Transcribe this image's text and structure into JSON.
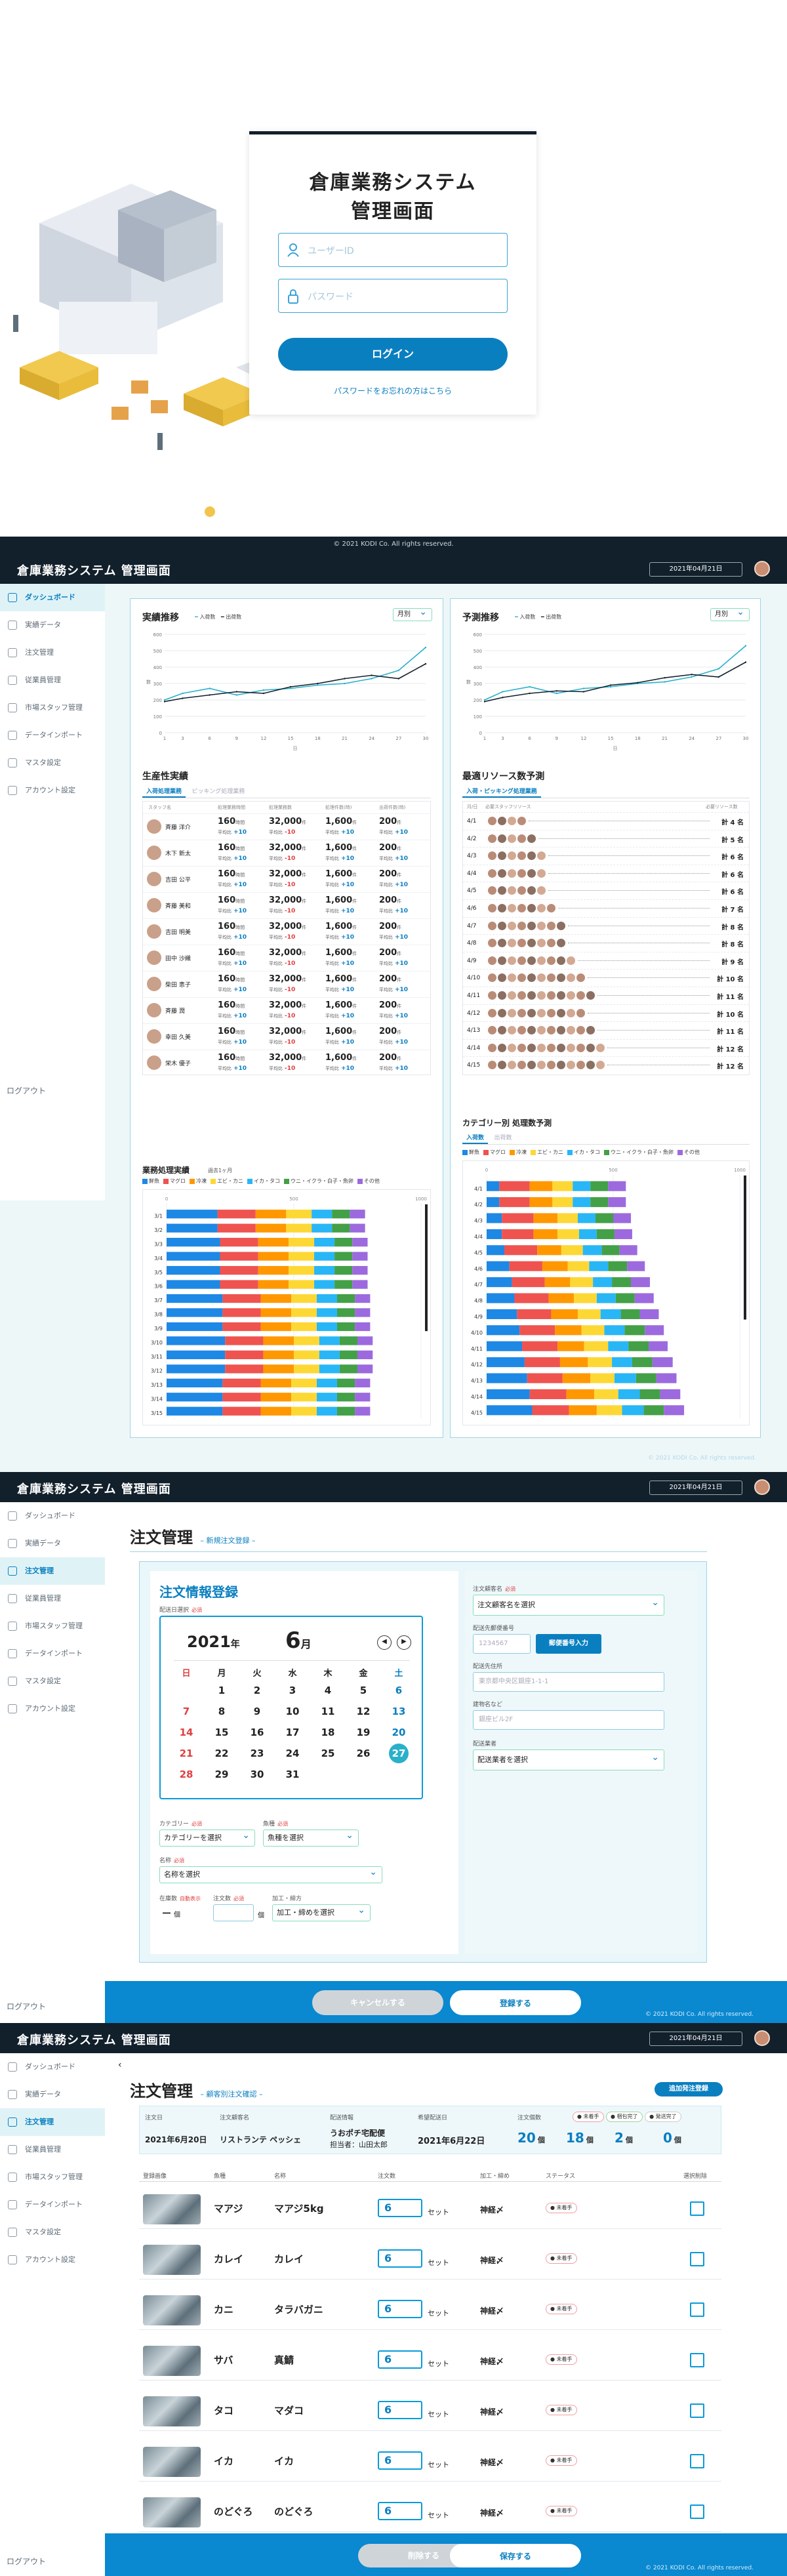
{
  "login": {
    "title_line1": "倉庫業務システム",
    "title_line2": "管理画面",
    "user_placeholder": "ユーザーID",
    "password_placeholder": "パスワード",
    "login_button": "ログイン",
    "forgot_link": "パスワードをお忘れの方はこちら",
    "copyright": "© 2021 KODI Co. All rights reserved."
  },
  "app": {
    "title": "倉庫業務システム 管理画面",
    "date": "2021年04月21日",
    "copyright": "© 2021 KODI Co. All rights reserved.",
    "logout": "ログアウト"
  },
  "sidebar": {
    "items": [
      {
        "label": "ダッシュボード",
        "icon": "home-icon"
      },
      {
        "label": "実績データ",
        "icon": "chart-icon"
      },
      {
        "label": "注文管理",
        "icon": "order-icon"
      },
      {
        "label": "従業員管理",
        "icon": "staff-icon"
      },
      {
        "label": "市場スタッフ管理",
        "icon": "people-icon"
      },
      {
        "label": "データインポート",
        "icon": "import-icon"
      },
      {
        "label": "マスタ設定",
        "icon": "master-icon"
      },
      {
        "label": "アカウント設定",
        "icon": "gear-icon"
      }
    ]
  },
  "dashboard": {
    "results_title": "実績推移",
    "results_legend": [
      "入荷数",
      "出荷数"
    ],
    "forecast_title": "予測推移",
    "forecast_legend": [
      "入荷数",
      "出荷数"
    ],
    "period_select": "月別",
    "productivity_title": "生産性実績",
    "productivity_tabs": [
      "入荷処理業務",
      "ピッキング処理業務"
    ],
    "productivity_headers": [
      "スタッフ名",
      "処理業務時間",
      "処理業務数",
      "処理件数(時)",
      "出荷件数(時)"
    ],
    "staff": [
      {
        "name": "斉藤 洋介",
        "d1": "+10",
        "d2": "-10",
        "d3": "+10",
        "d4": "+10"
      },
      {
        "name": "木下 新太",
        "d1": "+10",
        "d2": "-10",
        "d3": "+10",
        "d4": "+10"
      },
      {
        "name": "吉田 公平",
        "d1": "+10",
        "d2": "-10",
        "d3": "+10",
        "d4": "+10"
      },
      {
        "name": "斉藤 美和",
        "d1": "+10",
        "d2": "-10",
        "d3": "+10",
        "d4": "+10"
      },
      {
        "name": "吉田 明美",
        "d1": "+10",
        "d2": "-10",
        "d3": "+10",
        "d4": "+10"
      },
      {
        "name": "田中 沙織",
        "d1": "+10",
        "d2": "-10",
        "d3": "+10",
        "d4": "+10"
      },
      {
        "name": "柴田 恵子",
        "d1": "+10",
        "d2": "-10",
        "d3": "+10",
        "d4": "+10"
      },
      {
        "name": "斉藤 潤",
        "d1": "+10",
        "d2": "-10",
        "d3": "+10",
        "d4": "+10"
      },
      {
        "name": "幸田 久美",
        "d1": "+10",
        "d2": "-10",
        "d3": "+10",
        "d4": "+10"
      },
      {
        "name": "栄木 優子",
        "d1": "+10",
        "d2": "-10",
        "d3": "+10",
        "d4": "+10"
      }
    ],
    "metric_values": {
      "hours": "160",
      "hours_unit": "時間",
      "tasks": "32,000",
      "tasks_unit": "件",
      "rate1": "1,600",
      "rate1_unit": "件",
      "rate2": "200",
      "rate2_unit": "件",
      "avg_prefix": "平均比"
    },
    "resource_title": "最適リソース数予測",
    "resource_tabs": [
      "入荷・ピッキング処理業務"
    ],
    "resource_headers": [
      "月/日",
      "必要スタッフリソース",
      "必要リソース数"
    ],
    "resource_rows": [
      {
        "date": "4/1",
        "count": "計 4 名"
      },
      {
        "date": "4/2",
        "count": "計 5 名"
      },
      {
        "date": "4/3",
        "count": "計 6 名"
      },
      {
        "date": "4/4",
        "count": "計 6 名"
      },
      {
        "date": "4/5",
        "count": "計 6 名"
      },
      {
        "date": "4/6",
        "count": "計 7 名"
      },
      {
        "date": "4/7",
        "count": "計 8 名"
      },
      {
        "date": "4/8",
        "count": "計 8 名"
      },
      {
        "date": "4/9",
        "count": "計 9 名"
      },
      {
        "date": "4/10",
        "count": "計 10 名"
      },
      {
        "date": "4/11",
        "count": "計 11 名"
      },
      {
        "date": "4/12",
        "count": "計 10 名"
      },
      {
        "date": "4/13",
        "count": "計 11 名"
      },
      {
        "date": "4/14",
        "count": "計 12 名"
      },
      {
        "date": "4/15",
        "count": "計 12 名"
      }
    ],
    "category_colors": [
      "#1e88e5",
      "#ef5350",
      "#ff9800",
      "#fdd835",
      "#29b6f6",
      "#43a047",
      "#9c6ade",
      "#b39ddb"
    ],
    "category_names": [
      "鮮魚",
      "マグロ",
      "冷凍",
      "エビ・カニ",
      "イカ・タコ",
      "ウニ・イクラ・白子・魚卵",
      "その他"
    ],
    "task_title": "業務処理実績",
    "task_subtitle": "過去1ヶ月",
    "category_forecast_title": "カテゴリー別 処理数予測",
    "category_forecast_tabs": [
      "入荷数",
      "出荷数"
    ]
  },
  "chart_data": [
    {
      "type": "line",
      "title": "実績推移",
      "x": [
        1,
        3,
        6,
        9,
        12,
        15,
        18,
        21,
        24,
        27,
        30
      ],
      "series": [
        {
          "name": "入荷数",
          "values": [
            200,
            240,
            270,
            230,
            260,
            270,
            290,
            300,
            330,
            380,
            520
          ]
        },
        {
          "name": "出荷数",
          "values": [
            190,
            210,
            230,
            250,
            240,
            280,
            300,
            330,
            350,
            330,
            420
          ]
        }
      ],
      "xlabel": "日",
      "ylabel": "数",
      "ylim": [
        0,
        600
      ]
    },
    {
      "type": "line",
      "title": "予測推移",
      "x": [
        1,
        3,
        6,
        9,
        12,
        15,
        18,
        21,
        24,
        27,
        30
      ],
      "series": [
        {
          "name": "入荷数",
          "values": [
            200,
            250,
            280,
            240,
            270,
            280,
            300,
            310,
            340,
            390,
            530
          ]
        },
        {
          "name": "出荷数",
          "values": [
            190,
            215,
            240,
            255,
            250,
            290,
            305,
            335,
            355,
            340,
            430
          ]
        }
      ],
      "xlabel": "日",
      "ylabel": "数",
      "ylim": [
        0,
        600
      ]
    },
    {
      "type": "bar",
      "title": "業務処理実績",
      "categories": [
        "3/1",
        "3/2",
        "3/3",
        "3/4",
        "3/5",
        "3/6",
        "3/7",
        "3/8",
        "3/9",
        "3/10",
        "3/11",
        "3/12",
        "3/13",
        "3/14",
        "3/15"
      ],
      "xlim": [
        0,
        1000
      ],
      "series": [
        {
          "name": "鮮魚",
          "values": [
            200,
            200,
            210,
            210,
            210,
            210,
            220,
            220,
            220,
            230,
            230,
            230,
            220,
            220,
            220
          ]
        },
        {
          "name": "マグロ",
          "values": [
            150,
            150,
            150,
            150,
            150,
            150,
            150,
            150,
            150,
            150,
            150,
            150,
            150,
            150,
            150
          ]
        },
        {
          "name": "冷凍",
          "values": [
            120,
            120,
            120,
            120,
            120,
            120,
            120,
            120,
            120,
            120,
            120,
            120,
            120,
            120,
            120
          ]
        },
        {
          "name": "エビ・カニ",
          "values": [
            100,
            100,
            100,
            100,
            100,
            100,
            100,
            100,
            100,
            100,
            100,
            100,
            100,
            100,
            100
          ]
        },
        {
          "name": "イカ・タコ",
          "values": [
            80,
            80,
            80,
            80,
            80,
            80,
            80,
            80,
            80,
            80,
            80,
            80,
            80,
            80,
            80
          ]
        },
        {
          "name": "ウニ・イクラ・白子・魚卵",
          "values": [
            70,
            70,
            70,
            70,
            70,
            70,
            70,
            70,
            70,
            70,
            70,
            70,
            70,
            70,
            70
          ]
        },
        {
          "name": "その他",
          "values": [
            60,
            60,
            60,
            60,
            60,
            60,
            60,
            60,
            60,
            60,
            60,
            60,
            60,
            60,
            60
          ]
        }
      ]
    },
    {
      "type": "bar",
      "title": "カテゴリー別 処理数予測",
      "categories": [
        "4/1",
        "4/2",
        "4/3",
        "4/4",
        "4/5",
        "4/6",
        "4/7",
        "4/8",
        "4/9",
        "4/10",
        "4/11",
        "4/12",
        "4/13",
        "4/14",
        "4/15"
      ],
      "xlim": [
        0,
        1000
      ],
      "series": [
        {
          "name": "鮮魚",
          "values": [
            50,
            50,
            60,
            60,
            70,
            90,
            100,
            110,
            120,
            130,
            140,
            150,
            160,
            170,
            180
          ]
        },
        {
          "name": "マグロ",
          "values": [
            120,
            120,
            125,
            125,
            130,
            130,
            130,
            135,
            135,
            140,
            140,
            140,
            140,
            145,
            145
          ]
        },
        {
          "name": "冷凍",
          "values": [
            90,
            90,
            95,
            95,
            95,
            100,
            100,
            100,
            105,
            105,
            105,
            110,
            110,
            110,
            110
          ]
        },
        {
          "name": "エビ・カニ",
          "values": [
            80,
            80,
            80,
            85,
            85,
            85,
            90,
            90,
            90,
            90,
            95,
            95,
            95,
            95,
            100
          ]
        },
        {
          "name": "イカ・タコ",
          "values": [
            70,
            70,
            70,
            70,
            75,
            75,
            75,
            75,
            80,
            80,
            80,
            80,
            85,
            85,
            85
          ]
        },
        {
          "name": "ウニ・イクラ・白子・魚卵",
          "values": [
            70,
            70,
            70,
            70,
            70,
            75,
            75,
            75,
            75,
            80,
            80,
            80,
            80,
            80,
            80
          ]
        },
        {
          "name": "その他",
          "values": [
            70,
            70,
            70,
            70,
            70,
            70,
            75,
            75,
            75,
            75,
            75,
            80,
            80,
            80,
            80
          ]
        }
      ]
    }
  ],
  "order_new": {
    "title": "注文管理",
    "subtitle": "– 新規注文登録 –",
    "form_title": "注文情報登録",
    "delivery_label": "配送日選択",
    "required": "必須",
    "year": "2021",
    "year_suffix": "年",
    "month": "6",
    "month_suffix": "月",
    "weekdays": [
      "日",
      "月",
      "火",
      "水",
      "木",
      "金",
      "土"
    ],
    "weeks": [
      [
        "",
        "1",
        "2",
        "3",
        "4",
        "5",
        "6"
      ],
      [
        "7",
        "8",
        "9",
        "10",
        "11",
        "12",
        "13"
      ],
      [
        "14",
        "15",
        "16",
        "17",
        "18",
        "19",
        "20"
      ],
      [
        "21",
        "22",
        "23",
        "24",
        "25",
        "26",
        "27"
      ],
      [
        "28",
        "29",
        "30",
        "31",
        "",
        "",
        ""
      ]
    ],
    "selected_day": "27",
    "category_label": "カテゴリー",
    "category_value": "カテゴリーを選択",
    "fish_label": "魚種",
    "fish_value": "魚種を選択",
    "name_label": "名称",
    "name_value": "名称を選択",
    "unit_label": "在庫数",
    "unit_note": "自動表示",
    "unit_dash": "ー",
    "unit_suffix": "個",
    "order_qty_label": "注文数",
    "order_qty_suffix": "個",
    "process_label": "加工・締方",
    "process_value": "加工・締めを選択",
    "customer_label": "注文顧客名",
    "customer_value": "注文顧客名を選択",
    "zip_label": "配送先郵便番号",
    "zip_placeholder": "1234567",
    "zip_button": "郵便番号入力",
    "address_label": "配送先住所",
    "address_placeholder": "東京都中央区銀座1-1-1",
    "building_label": "建物名など",
    "building_placeholder": "銀座ビル2F",
    "carrier_label": "配送業者",
    "carrier_value": "配送業者を選択",
    "cancel_button": "キャンセルする",
    "register_button": "登録する"
  },
  "order_list": {
    "title": "注文管理",
    "subtitle": "– 顧客別注文確認 –",
    "add_button": "追加発注登録",
    "headers": [
      "注文日",
      "注文顧客名",
      "配送情報",
      "希望配送日",
      "注文個数"
    ],
    "order_date": "2021年6月20日",
    "customer": "リストランテ ペッシェ",
    "carrier": "うおポチ宅配便",
    "contact": "担当者：山田太郎",
    "wish_date": "2021年6月22日",
    "badges": [
      "未着手",
      "梱包完了",
      "発送完了"
    ],
    "counts": [
      {
        "value": "20",
        "unit": "個"
      },
      {
        "value": "18",
        "unit": "個"
      },
      {
        "value": "2",
        "unit": "個"
      },
      {
        "value": "0",
        "unit": "個"
      }
    ],
    "item_headers": [
      "登録画像",
      "魚種",
      "名称",
      "注文数",
      "加工・締め",
      "ステータス",
      "選択削除"
    ],
    "items": [
      {
        "fish": "マアジ",
        "name": "マアジ5kg",
        "qty": "6",
        "unit": "セット",
        "process": "神経〆",
        "status": "未着手"
      },
      {
        "fish": "カレイ",
        "name": "カレイ",
        "qty": "6",
        "unit": "セット",
        "process": "神経〆",
        "status": "未着手"
      },
      {
        "fish": "カニ",
        "name": "タラバガニ",
        "qty": "6",
        "unit": "セット",
        "process": "神経〆",
        "status": "未着手"
      },
      {
        "fish": "サバ",
        "name": "真鯖",
        "qty": "6",
        "unit": "セット",
        "process": "神経〆",
        "status": "未着手"
      },
      {
        "fish": "タコ",
        "name": "マダコ",
        "qty": "6",
        "unit": "セット",
        "process": "神経〆",
        "status": "未着手"
      },
      {
        "fish": "イカ",
        "name": "イカ",
        "qty": "6",
        "unit": "セット",
        "process": "神経〆",
        "status": "未着手"
      },
      {
        "fish": "のどぐろ",
        "name": "のどぐろ",
        "qty": "6",
        "unit": "セット",
        "process": "神経〆",
        "status": "未着手"
      }
    ],
    "delete_button": "削除する",
    "save_button": "保存する"
  }
}
